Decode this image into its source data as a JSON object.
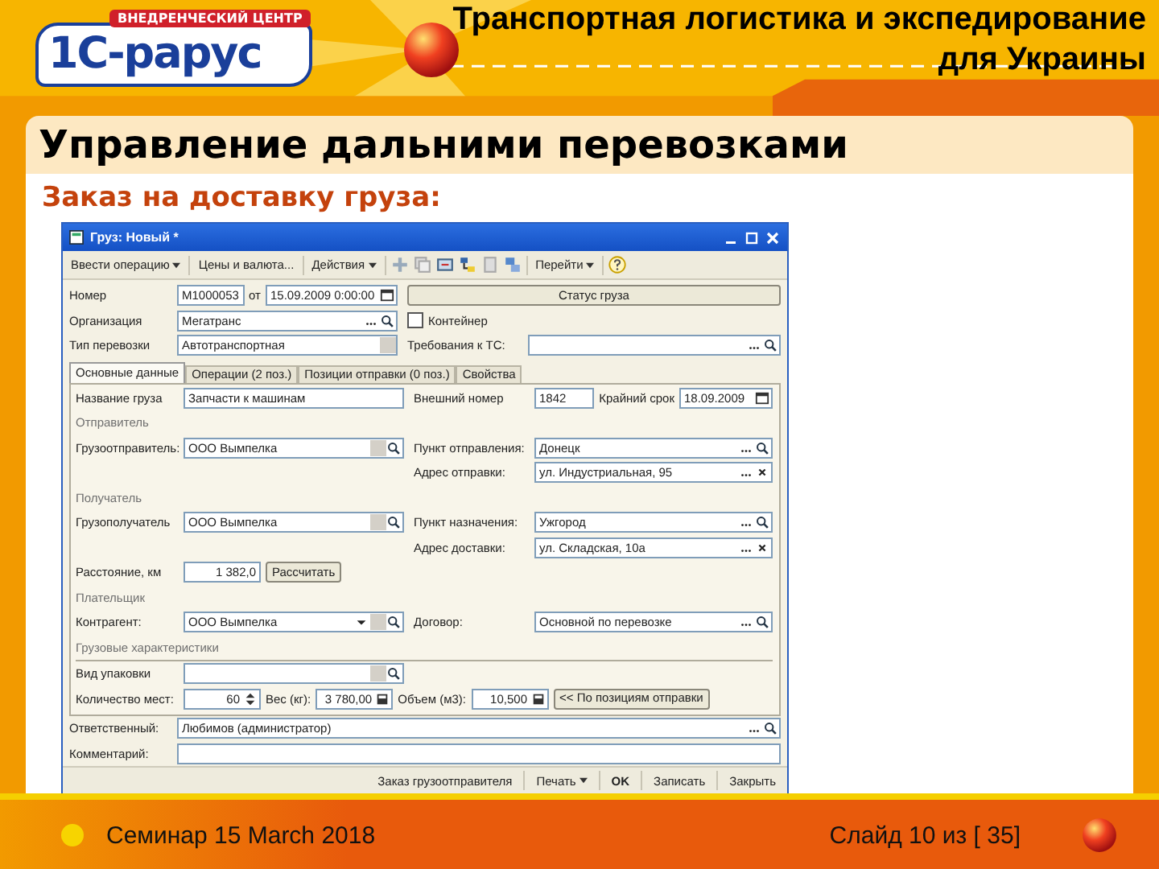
{
  "header": {
    "logo": {
      "badge": "ВНЕДРЕНЧЕСКИЙ ЦЕНТР",
      "name": "1С-рарус"
    },
    "title_lines": [
      "Транспортная логистика и экспедирование",
      "для Украины"
    ]
  },
  "slide_title": "Управление дальними перевозками",
  "subtitle": "Заказ на доставку груза:",
  "form": {
    "title": "Груз: Новый *",
    "toolbar": [
      {
        "label": "Ввести операцию",
        "dropdown": true
      },
      {
        "label": "Цены и валюта...",
        "dropdown": false
      },
      {
        "label": "Действия",
        "dropdown": true
      },
      {
        "label": "Перейти",
        "dropdown": true
      }
    ],
    "header_rows": [
      {
        "kind": "pair",
        "left": [
          {
            "kind": "label",
            "text": "Номер"
          },
          {
            "kind": "text",
            "value": "М1000053"
          },
          {
            "kind": "label",
            "text": "от"
          },
          {
            "kind": "datetime",
            "value": "15.09.2009 0:00:00"
          }
        ],
        "right": [
          {
            "kind": "button",
            "text": "Статус груза"
          }
        ]
      },
      {
        "kind": "pair",
        "left": [
          {
            "kind": "label",
            "text": "Организация"
          },
          {
            "kind": "ref",
            "value": "Мегатранс"
          }
        ],
        "right": [
          {
            "kind": "checkbox",
            "text": "Контейнер",
            "checked": false
          }
        ]
      },
      {
        "kind": "pair",
        "left": [
          {
            "kind": "label",
            "text": "Тип перевозки"
          },
          {
            "kind": "list",
            "value": "Автотранспортная"
          }
        ],
        "right": [
          {
            "kind": "label",
            "text": "Требования к ТС:"
          },
          {
            "kind": "ref"
          }
        ]
      }
    ],
    "tabs": [
      {
        "label": "Основные данные",
        "selected": true
      },
      {
        "label": "Операции (2 поз.)",
        "selected": false
      },
      {
        "label": "Позиции отправки (0 поз.)",
        "selected": false
      },
      {
        "label": "Свойства",
        "selected": false
      }
    ],
    "panel_rows": [
      {
        "kind": "pair",
        "left": [
          {
            "kind": "label",
            "text": "Название груза"
          },
          {
            "kind": "text",
            "value": "Запчасти к машинам"
          }
        ],
        "right": [
          {
            "kind": "label",
            "text": "Внешний номер"
          },
          {
            "kind": "text",
            "value": "1842"
          },
          {
            "kind": "label",
            "text": "Крайний срок"
          },
          {
            "kind": "date",
            "value": "18.09.2009"
          }
        ]
      },
      {
        "kind": "section",
        "text": "Отправитель",
        "rule": false
      },
      {
        "kind": "pair",
        "left": [
          {
            "kind": "label",
            "text": "Грузоотправитель:"
          },
          {
            "kind": "pick",
            "value": "ООО Вымпелка"
          }
        ],
        "right": [
          {
            "kind": "label",
            "text": "Пункт отправления:"
          },
          {
            "kind": "ref",
            "value": "Донецк"
          }
        ]
      },
      {
        "kind": "pair",
        "right": [
          {
            "kind": "label",
            "text": "Адрес отправки:"
          },
          {
            "kind": "ref_clear",
            "value": "ул. Индустриальная, 95"
          }
        ]
      },
      {
        "kind": "section",
        "text": "Получатель",
        "rule": false
      },
      {
        "kind": "pair",
        "left": [
          {
            "kind": "label",
            "text": "Грузополучатель"
          },
          {
            "kind": "pick",
            "value": "ООО Вымпелка"
          }
        ],
        "right": [
          {
            "kind": "label",
            "text": "Пункт назначения:"
          },
          {
            "kind": "ref",
            "value": "Ужгород"
          }
        ]
      },
      {
        "kind": "pair",
        "right": [
          {
            "kind": "label",
            "text": "Адрес доставки:"
          },
          {
            "kind": "ref_clear",
            "value": "ул. Складская, 10а"
          }
        ]
      },
      {
        "kind": "pair",
        "left": [
          {
            "kind": "label",
            "text": "Расстояние, км"
          },
          {
            "kind": "number",
            "value": "1 382,0"
          },
          {
            "kind": "button",
            "text": "Рассчитать"
          }
        ]
      },
      {
        "kind": "section",
        "text": "Плательщик",
        "rule": false
      },
      {
        "kind": "pair",
        "left": [
          {
            "kind": "label",
            "text": "Контрагент:"
          },
          {
            "kind": "combo",
            "value": "ООО Вымпелка"
          }
        ],
        "right": [
          {
            "kind": "label",
            "text": "Договор:"
          },
          {
            "kind": "ref",
            "value": "Основной по перевозке"
          }
        ]
      },
      {
        "kind": "section",
        "text": "Грузовые характеристики",
        "rule": true
      },
      {
        "kind": "pair",
        "left": [
          {
            "kind": "label",
            "text": "Вид упаковки"
          },
          {
            "kind": "pick"
          }
        ]
      },
      {
        "kind": "wide",
        "items": [
          {
            "kind": "label",
            "text": "Количество мест:"
          },
          {
            "kind": "spin_number",
            "value": "60"
          },
          {
            "kind": "label",
            "text": "Вес (кг):"
          },
          {
            "kind": "calc_number",
            "value": "3 780,00"
          },
          {
            "kind": "label",
            "text": "Объем (м3):"
          },
          {
            "kind": "calc_number",
            "value": "10,500"
          },
          {
            "kind": "button",
            "text": "<< По позициям отправки"
          }
        ]
      }
    ],
    "bottom_rows": [
      {
        "kind": "wide",
        "items": [
          {
            "kind": "label",
            "text": "Ответственный:"
          },
          {
            "kind": "ref",
            "value": "Любимов (администратор)"
          }
        ]
      },
      {
        "kind": "wide",
        "items": [
          {
            "kind": "label",
            "text": "Комментарий:"
          },
          {
            "kind": "text"
          }
        ]
      }
    ],
    "footer_buttons": [
      {
        "label": "Заказ грузоотправителя",
        "dropdown": false,
        "default": false
      },
      {
        "label": "Печать",
        "dropdown": true,
        "default": false
      },
      {
        "label": "OK",
        "dropdown": false,
        "default": true
      },
      {
        "label": "Записать",
        "dropdown": false,
        "default": false
      },
      {
        "label": "Закрыть",
        "dropdown": false,
        "default": false
      }
    ]
  },
  "footer": {
    "seminar": "Семинар 15 March 2018",
    "slide": "Слайд 10 из [ 35]"
  }
}
